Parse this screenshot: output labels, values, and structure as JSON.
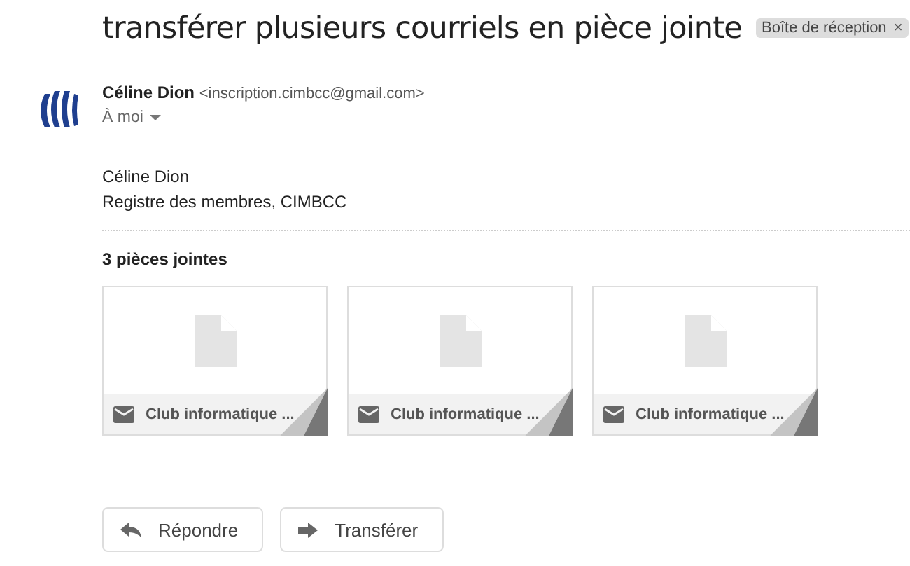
{
  "subject": "transférer plusieurs courriels en pièce jointe",
  "label": {
    "text": "Boîte de réception",
    "close": "×"
  },
  "sender": {
    "name": "Céline Dion",
    "email": "<inscription.cimbcc@gmail.com>",
    "to": "À moi"
  },
  "body": [
    "Céline Dion",
    "Registre des membres, CIMBCC"
  ],
  "attachments_title": "3 pièces jointes",
  "attachments": [
    {
      "name": "Club informatique ..."
    },
    {
      "name": "Club informatique ..."
    },
    {
      "name": "Club informatique ..."
    }
  ],
  "buttons": [
    {
      "kind": "reply",
      "label": "Répondre"
    },
    {
      "kind": "forward",
      "label": "Transférer"
    }
  ]
}
